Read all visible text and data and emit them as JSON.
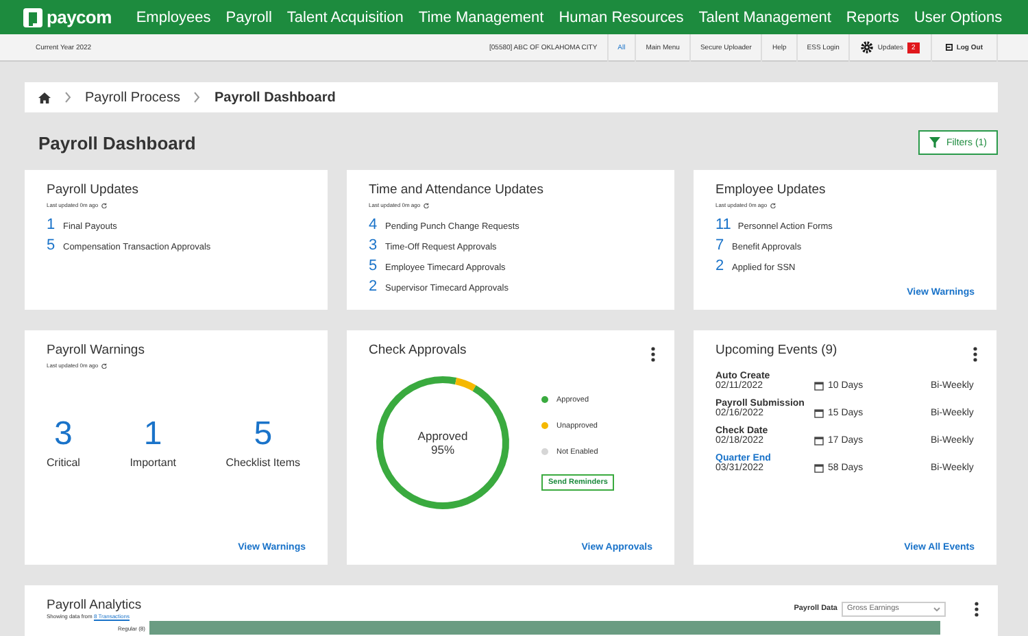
{
  "topnav": {
    "logo": "paycom",
    "items": [
      "Employees",
      "Payroll",
      "Talent Acquisition",
      "Time Management",
      "Human Resources",
      "Talent Management",
      "Reports",
      "User Options"
    ]
  },
  "subbar": {
    "year": "Current Year 2022",
    "company": "[05580] ABC OF OKLAHOMA CITY",
    "links": [
      {
        "label": "All",
        "selected": true
      },
      {
        "label": "Main Menu",
        "selected": false
      },
      {
        "label": "Secure Uploader",
        "selected": false
      },
      {
        "label": "Help",
        "selected": false
      },
      {
        "label": "ESS Login",
        "selected": false
      }
    ],
    "updates": "Updates",
    "updates_count": "2",
    "logout": "Log Out"
  },
  "breadcrumb": [
    "Payroll Process",
    "Payroll Dashboard"
  ],
  "page_title": "Payroll Dashboard",
  "filters": "Filters (1)",
  "update_cards": [
    {
      "title": "Payroll Updates",
      "updated": "Last updated 0m ago",
      "items": [
        {
          "count": "1",
          "label": "Final Payouts"
        },
        {
          "count": "5",
          "label": "Compensation Transaction Approvals"
        }
      ]
    },
    {
      "title": "Time and Attendance Updates",
      "updated": "Last updated 0m ago",
      "items": [
        {
          "count": "4",
          "label": "Pending Punch Change Requests"
        },
        {
          "count": "3",
          "label": "Time-Off Request Approvals"
        },
        {
          "count": "5",
          "label": "Employee Timecard Approvals"
        },
        {
          "count": "2",
          "label": "Supervisor Timecard Approvals"
        }
      ]
    },
    {
      "title": "Employee Updates",
      "updated": "Last updated 0m ago",
      "items": [
        {
          "count": "11",
          "label": "Personnel Action Forms"
        },
        {
          "count": "7",
          "label": "Benefit Approvals"
        },
        {
          "count": "2",
          "label": "Applied for SSN"
        }
      ],
      "link": "View Warnings"
    }
  ],
  "warnings": {
    "title": "Payroll Warnings",
    "updated": "Last updated 0m ago",
    "stats": [
      {
        "count": "3",
        "label": "Critical"
      },
      {
        "count": "1",
        "label": "Important"
      },
      {
        "count": "5",
        "label": "Checklist Items"
      }
    ],
    "link": "View Warnings"
  },
  "check_approvals": {
    "title": "Check Approvals",
    "center_label": "Approved",
    "center_value": "95%",
    "legend": [
      {
        "label": "Approved",
        "color": "#3aaa3f"
      },
      {
        "label": "Unapproved",
        "color": "#f5b800"
      },
      {
        "label": "Not Enabled",
        "color": "#d6d6d6"
      }
    ],
    "button": "Send Reminders",
    "link": "View Approvals"
  },
  "events": {
    "title": "Upcoming Events (9)",
    "rows": [
      {
        "name": "Auto Create",
        "date": "02/11/2022",
        "days": "10 Days",
        "frequency": "Bi-Weekly",
        "highlighted": false
      },
      {
        "name": "Payroll Submission",
        "date": "02/16/2022",
        "days": "15 Days",
        "frequency": "Bi-Weekly",
        "highlighted": false
      },
      {
        "name": "Check Date",
        "date": "02/18/2022",
        "days": "17 Days",
        "frequency": "Bi-Weekly",
        "highlighted": false
      },
      {
        "name": "Quarter End",
        "date": "03/31/2022",
        "days": "58 Days",
        "frequency": "Bi-Weekly",
        "highlighted": true
      }
    ],
    "link": "View All Events"
  },
  "analytics": {
    "title": "Payroll Analytics",
    "subtitle": "Showing data from",
    "subtitle_link": "8 Transactions",
    "select_label": "Payroll Data",
    "select_value": "Gross Earnings",
    "bar_label": "Regular (8)"
  }
}
